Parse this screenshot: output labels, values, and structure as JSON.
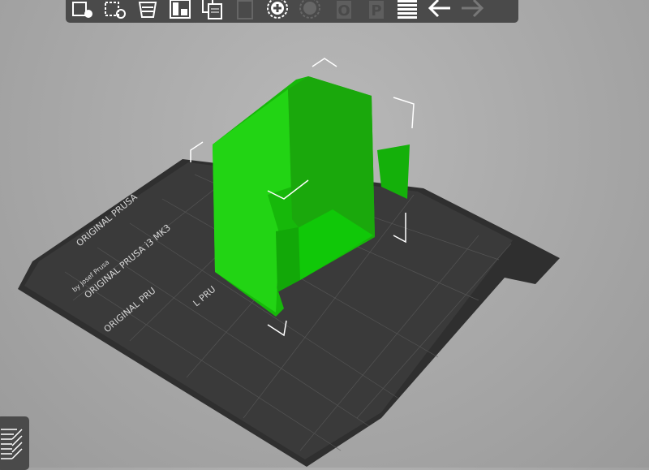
{
  "toolbar": {
    "buttons": [
      {
        "name": "add-icon",
        "enabled": true
      },
      {
        "name": "delete-icon",
        "enabled": true
      },
      {
        "name": "delete-all-icon",
        "enabled": true
      },
      {
        "name": "arrange-icon",
        "enabled": true
      },
      {
        "name": "copy-icon",
        "enabled": true
      },
      {
        "name": "paste-icon",
        "enabled": false
      },
      {
        "name": "add-instance-icon",
        "enabled": true
      },
      {
        "name": "remove-instance-icon",
        "enabled": false
      },
      {
        "name": "split-objects-icon",
        "label": "O",
        "enabled": false
      },
      {
        "name": "split-parts-icon",
        "label": "P",
        "enabled": false
      },
      {
        "name": "layers-editing-icon",
        "enabled": true
      },
      {
        "name": "undo-icon",
        "enabled": true
      },
      {
        "name": "redo-icon",
        "enabled": false
      }
    ]
  },
  "bed": {
    "logo_text": "ORIGINAL PRUSA i3 MK3",
    "logo_sub": "by Josef Prusa",
    "repeat_text": "ORIGINAL PRUSA",
    "repeat_text_2": "ORIGINAL PRU",
    "repeat_text_3": "L PRU"
  },
  "colors": {
    "object": "#1fcc10",
    "bed": "#333333",
    "toolbar": "#4a4a4a"
  }
}
